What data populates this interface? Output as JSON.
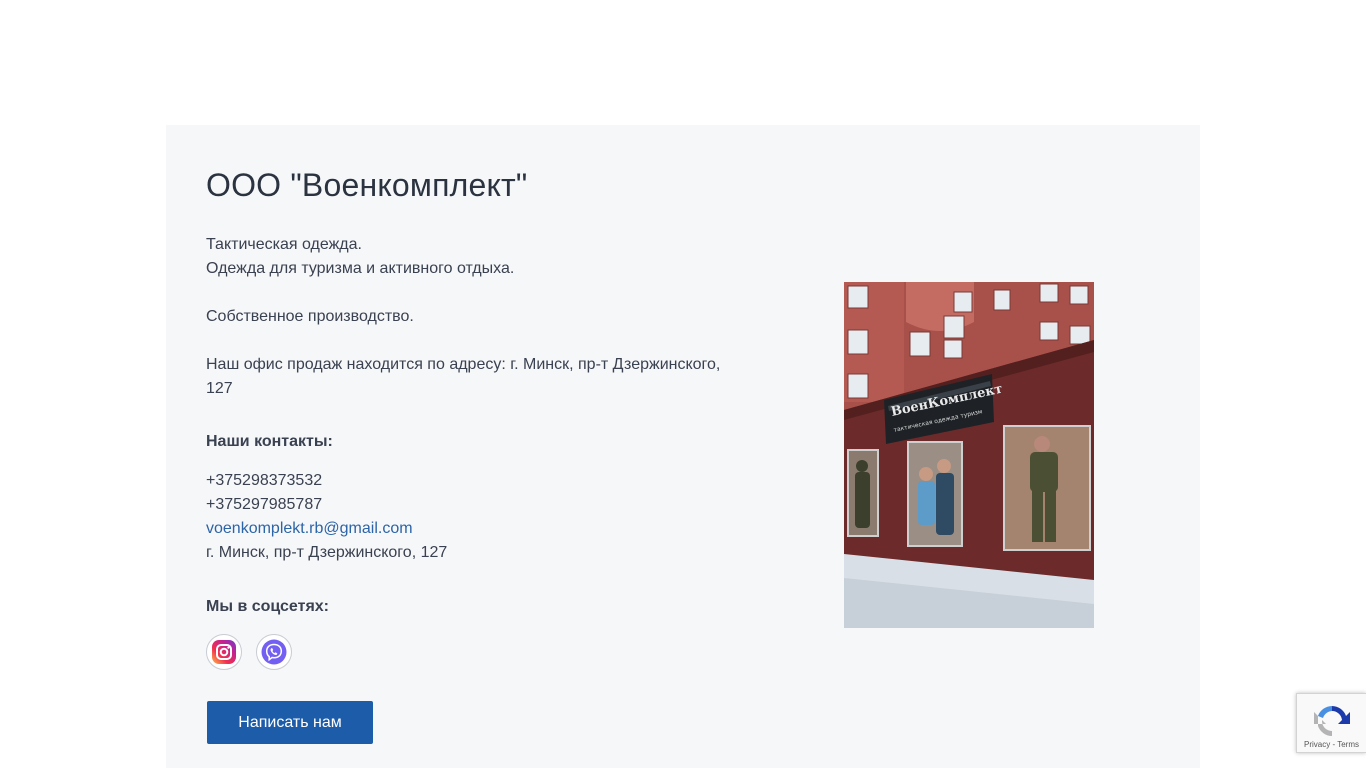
{
  "company": {
    "title": "ООО \"Военкомплект\"",
    "lines": [
      "Тактическая одежда.",
      "Одежда для туризма и активного отдыха.",
      "",
      "Собственное производство.",
      "",
      "Наш офис продаж находится по адресу: г. Минск, пр-т Дзержинского,",
      "127"
    ]
  },
  "contacts": {
    "heading": "Наши контакты:",
    "phone1": "+375298373532",
    "phone2": "+375297985787",
    "email": "voenkomplekt.rb@gmail.com",
    "address": "г. Минск, пр-т Дзержинского, 127"
  },
  "social": {
    "heading": "Мы в соцсетях:",
    "icons": [
      "instagram-icon",
      "viber-icon"
    ]
  },
  "cta": {
    "label": "Написать нам"
  },
  "photo": {
    "sign_title": "ВоенКомплект",
    "sign_subtitle": "тактическая одежда     туризм"
  },
  "recaptcha": {
    "links": "Privacy - Terms"
  },
  "colors": {
    "accent": "#1d5ca8",
    "link": "#2c64a8",
    "card_bg": "#f6f7f9",
    "text": "#3a4150"
  }
}
